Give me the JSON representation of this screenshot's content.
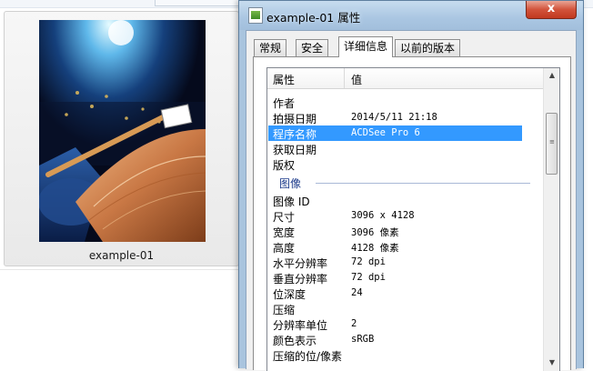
{
  "explorer": {
    "file_label": "example-01"
  },
  "dialog": {
    "title": "example-01 属性",
    "close_label": "x",
    "tabs": [
      "常规",
      "安全",
      "详细信息",
      "以前的版本"
    ],
    "active_tab_index": 2,
    "list_header": {
      "property": "属性",
      "value": "值"
    },
    "rows_top": [
      {
        "key": "作者",
        "value": ""
      },
      {
        "key": "拍摄日期",
        "value": "2014/5/11 21:18"
      },
      {
        "key": "程序名称",
        "value": "ACDSee Pro 6",
        "selected": true
      },
      {
        "key": "获取日期",
        "value": ""
      },
      {
        "key": "版权",
        "value": ""
      }
    ],
    "group_label": "图像",
    "rows_image": [
      {
        "key": "图像 ID",
        "value": ""
      },
      {
        "key": "尺寸",
        "value": "3096 x 4128"
      },
      {
        "key": "宽度",
        "value": "3096 像素"
      },
      {
        "key": "高度",
        "value": "4128 像素"
      },
      {
        "key": "水平分辨率",
        "value": "72 dpi"
      },
      {
        "key": "垂直分辨率",
        "value": "72 dpi"
      },
      {
        "key": "位深度",
        "value": "24"
      },
      {
        "key": "压缩",
        "value": ""
      },
      {
        "key": "分辨率单位",
        "value": "2"
      },
      {
        "key": "颜色表示",
        "value": "sRGB"
      },
      {
        "key": "压缩的位/像素",
        "value": ""
      }
    ]
  },
  "colors": {
    "selection": "#3399ff",
    "group_text": "#1e3c8c",
    "titlebar": "#aac6e2",
    "close_button": "#c1391f"
  },
  "icons": {
    "title_icon": "image-file-icon",
    "scroll_up": "triangle-up",
    "scroll_down": "triangle-down"
  }
}
